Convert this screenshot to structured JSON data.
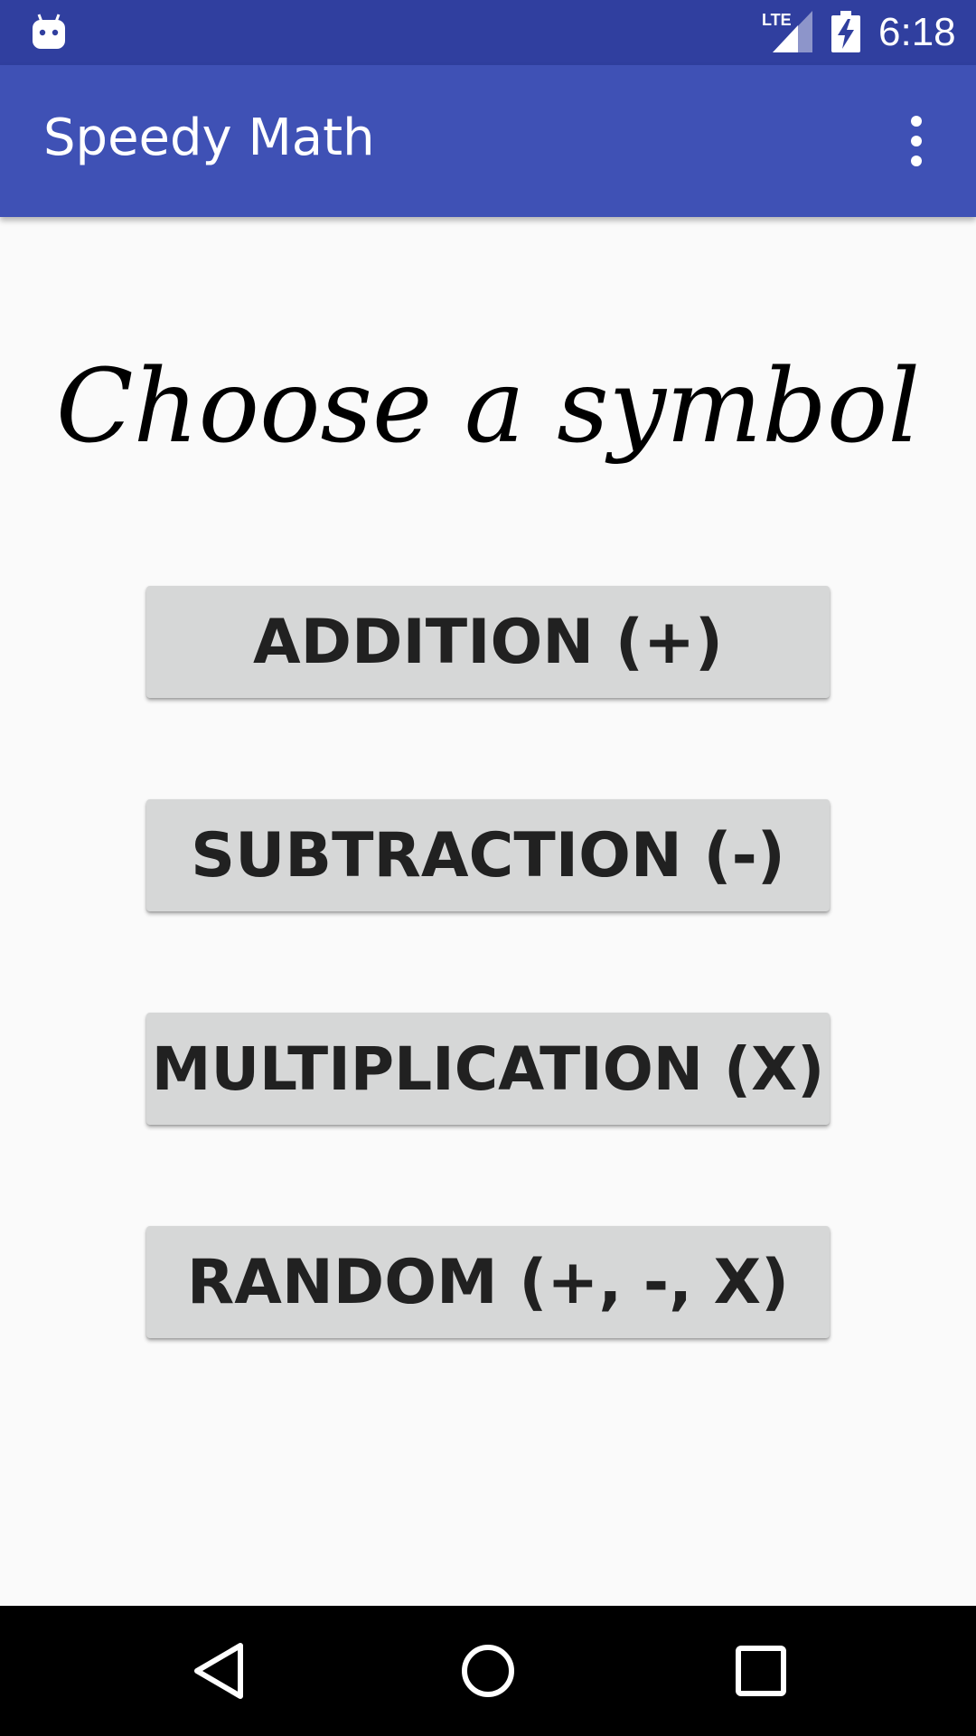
{
  "status_bar": {
    "network_label": "LTE",
    "time": "6:18",
    "icons": [
      "android-icon",
      "lte-signal-icon",
      "battery-charging-icon"
    ]
  },
  "app_bar": {
    "title": "Speedy Math",
    "menu_icon": "more-vert-icon"
  },
  "main": {
    "heading": "Choose a symbol",
    "buttons": [
      {
        "label": "ADDITION (+)"
      },
      {
        "label": "SUBTRACTION (-)"
      },
      {
        "label": "MULTIPLICATION (X)"
      },
      {
        "label": "RANDOM (+, -, X)"
      }
    ]
  },
  "nav_bar": {
    "icons": [
      "back-icon",
      "home-icon",
      "recent-apps-icon"
    ]
  },
  "colors": {
    "status_bar": "#303f9f",
    "app_bar": "#3f51b5",
    "background": "#fafafa",
    "button": "#d6d7d7",
    "button_text": "#212121",
    "nav_bar": "#000000"
  }
}
